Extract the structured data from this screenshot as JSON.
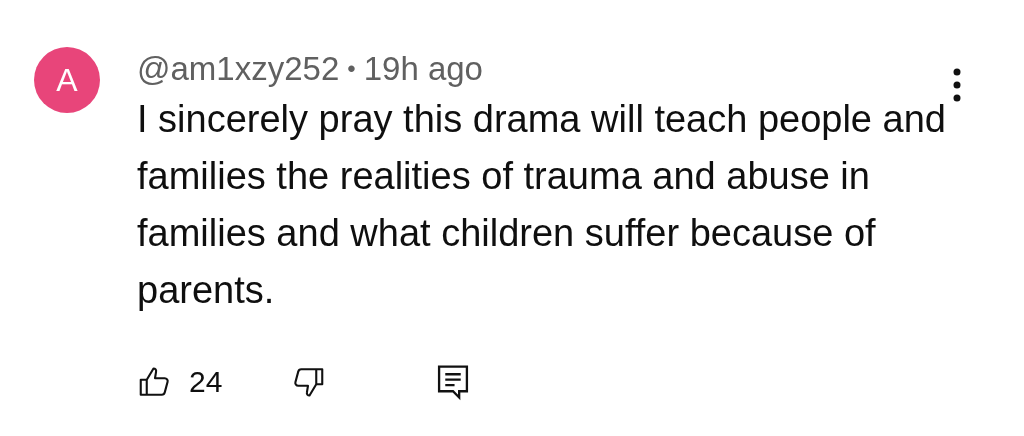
{
  "comment": {
    "avatar_letter": "A",
    "author": "@am1xzy252",
    "separator": "•",
    "time": "19h ago",
    "text": "I sincerely pray this drama will teach people and families the realities of trauma and abuse in families and what children suffer because of parents.",
    "likes": "24"
  }
}
